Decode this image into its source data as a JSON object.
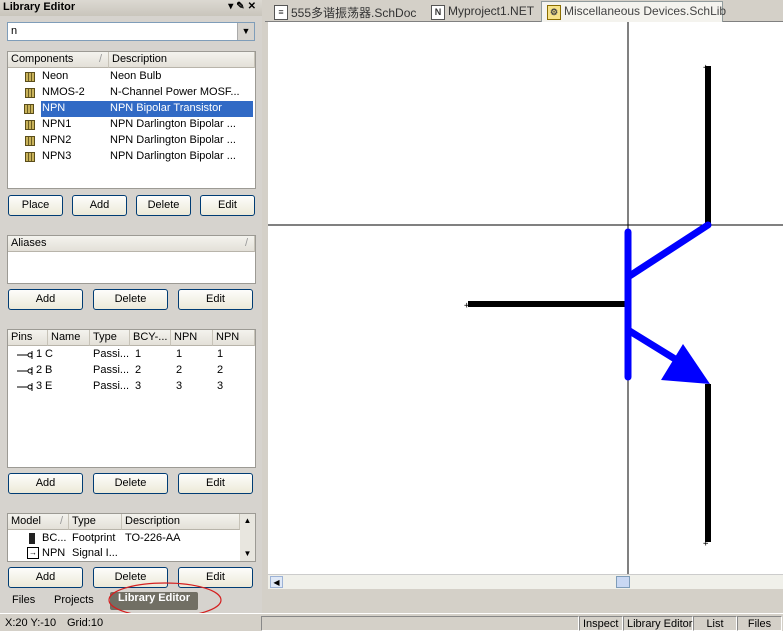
{
  "panel": {
    "title": "Library Editor",
    "filter_value": "n",
    "components": {
      "headers": [
        "Components",
        "Description"
      ],
      "rows": [
        {
          "name": "Neon",
          "desc": "Neon Bulb"
        },
        {
          "name": "NMOS-2",
          "desc": "N-Channel Power MOSF..."
        },
        {
          "name": "NPN",
          "desc": "NPN Bipolar Transistor"
        },
        {
          "name": "NPN1",
          "desc": "NPN Darlington Bipolar ..."
        },
        {
          "name": "NPN2",
          "desc": "NPN Darlington Bipolar ..."
        },
        {
          "name": "NPN3",
          "desc": "NPN Darlington Bipolar ..."
        }
      ],
      "selected": "NPN"
    },
    "comp_buttons": [
      "Place",
      "Add",
      "Delete",
      "Edit"
    ],
    "aliases_header": "Aliases",
    "alias_buttons": [
      "Add",
      "Delete",
      "Edit"
    ],
    "pins": {
      "headers": [
        "Pins",
        "Name",
        "Type",
        "BCY-...",
        "NPN",
        "NPN"
      ],
      "rows": [
        {
          "pin": "1",
          "name": "C",
          "type": "Passi...",
          "a": "1",
          "b": "1",
          "c": "1"
        },
        {
          "pin": "2",
          "name": "B",
          "type": "Passi...",
          "a": "2",
          "b": "2",
          "c": "2"
        },
        {
          "pin": "3",
          "name": "E",
          "type": "Passi...",
          "a": "3",
          "b": "3",
          "c": "3"
        }
      ]
    },
    "pin_buttons": [
      "Add",
      "Delete",
      "Edit"
    ],
    "models": {
      "headers": [
        "Model",
        "Type",
        "Description"
      ],
      "rows": [
        {
          "model": "BC...",
          "type": "Footprint",
          "desc": "TO-226-AA"
        },
        {
          "model": "NPN",
          "type": "Signal I...",
          "desc": ""
        }
      ]
    },
    "model_buttons": [
      "Add",
      "Delete",
      "Edit"
    ],
    "bottom_tabs": [
      "Files",
      "Projects",
      "Library Editor"
    ]
  },
  "doc_tabs": [
    {
      "label": "555多谐振荡器.SchDoc",
      "icon": "schdoc-icon"
    },
    {
      "label": "Myproject1.NET",
      "icon": "net-file-icon"
    },
    {
      "label": "Miscellaneous Devices.SchLib",
      "icon": "schlib-icon"
    }
  ],
  "active_doc_tab": "Miscellaneous Devices.SchLib",
  "colors": {
    "accent": "#316ac5",
    "symbol_body": "#0000ff",
    "pin": "#000000",
    "annotation": "#d42020"
  },
  "status": {
    "coords": "X:20 Y:-10",
    "grid": "Grid:10",
    "right": [
      "Inspect",
      "Library Editor",
      "List",
      "Files"
    ]
  }
}
